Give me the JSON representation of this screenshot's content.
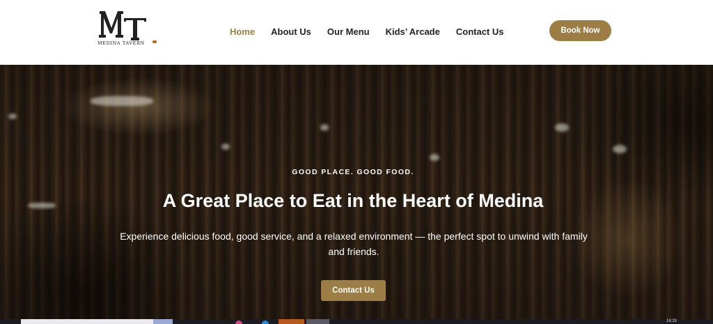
{
  "header": {
    "logo": {
      "letters": "MT",
      "text": "MEDINA TAVERN"
    },
    "nav": [
      {
        "label": "Home",
        "active": true
      },
      {
        "label": "About Us",
        "active": false
      },
      {
        "label": "Our Menu",
        "active": false
      },
      {
        "label": "Kids’ Arcade",
        "active": false
      },
      {
        "label": "Contact Us",
        "active": false
      }
    ],
    "book_button": "Book Now"
  },
  "hero": {
    "eyebrow": "GOOD PLACE. GOOD FOOD.",
    "title": "A Great Place to Eat in the Heart of Medina",
    "description": "Experience delicious food, good service, and a relaxed environment — the perfect spot to unwind with family and friends.",
    "cta_button": "Contact Us"
  },
  "taskbar": {
    "clock": "16:33"
  },
  "colors": {
    "accent": "#9b7d45",
    "nav_text": "#222222",
    "hero_text": "#ffffff",
    "hero_bg": "#2a1d13"
  }
}
